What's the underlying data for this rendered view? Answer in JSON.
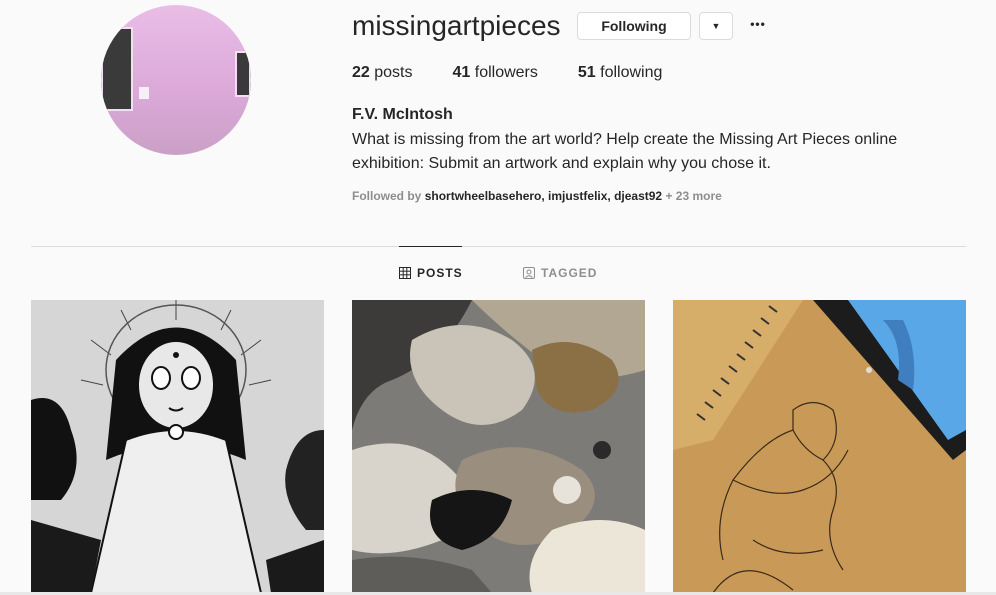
{
  "profile": {
    "username": "missingartpieces",
    "follow_label": "Following",
    "dropdown_icon": "▼",
    "more_icon": "•••",
    "posts_count": "22",
    "posts_label": "posts",
    "followers_count": "41",
    "followers_label": "followers",
    "following_count": "51",
    "following_label": "following",
    "full_name": "F.V. McIntosh",
    "bio": "What is missing from the art world? Help create the Missing Art Pieces online exhibition: Submit an artwork and explain why you chose it.",
    "followed_by_prefix": "Followed by",
    "followed_by_users": "shortwheelbasehero, imjustfelix, djeast92",
    "followed_by_more": "+ 23 more"
  },
  "tabs": [
    {
      "label": "POSTS",
      "icon": "grid-icon",
      "active": true
    },
    {
      "label": "TAGGED",
      "icon": "tag-icon",
      "active": false
    }
  ],
  "colors": {
    "background": "#fafafa",
    "text": "#262626",
    "muted": "#8e8e8e",
    "border": "#dbdbdb"
  }
}
